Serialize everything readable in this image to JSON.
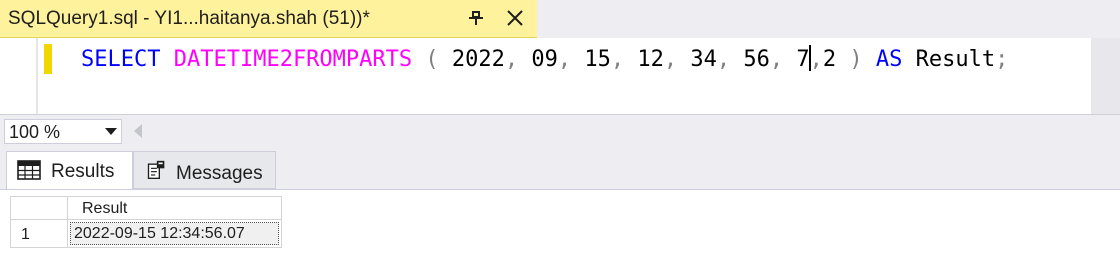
{
  "tab": {
    "title": "SQLQuery1.sql - YI1...haitanya.shah (51))*",
    "pin_icon": "pin-icon",
    "close_icon": "close-icon",
    "color": "#fff29d"
  },
  "editor": {
    "kw_select": "SELECT",
    "fn_name": "DATETIME2FROMPARTS",
    "open_paren": "(",
    "args": [
      "2022",
      "09",
      "15",
      "12",
      "34",
      "56",
      "7",
      "2"
    ],
    "comma": ",",
    "close_paren": ")",
    "kw_as": "AS",
    "alias": "Result",
    "semicolon": ";",
    "keyword_color": "#0000ff",
    "function_color": "#ff00ff",
    "punct_color": "#808080"
  },
  "zoom": {
    "value": "100 %"
  },
  "result_tabs": [
    {
      "label": "Results",
      "icon": "grid-icon",
      "active": true
    },
    {
      "label": "Messages",
      "icon": "messages-icon",
      "active": false
    }
  ],
  "grid": {
    "columns": [
      "Result"
    ],
    "rows": [
      {
        "num": "1",
        "values": [
          "2022-09-15 12:34:56.07"
        ]
      }
    ]
  }
}
